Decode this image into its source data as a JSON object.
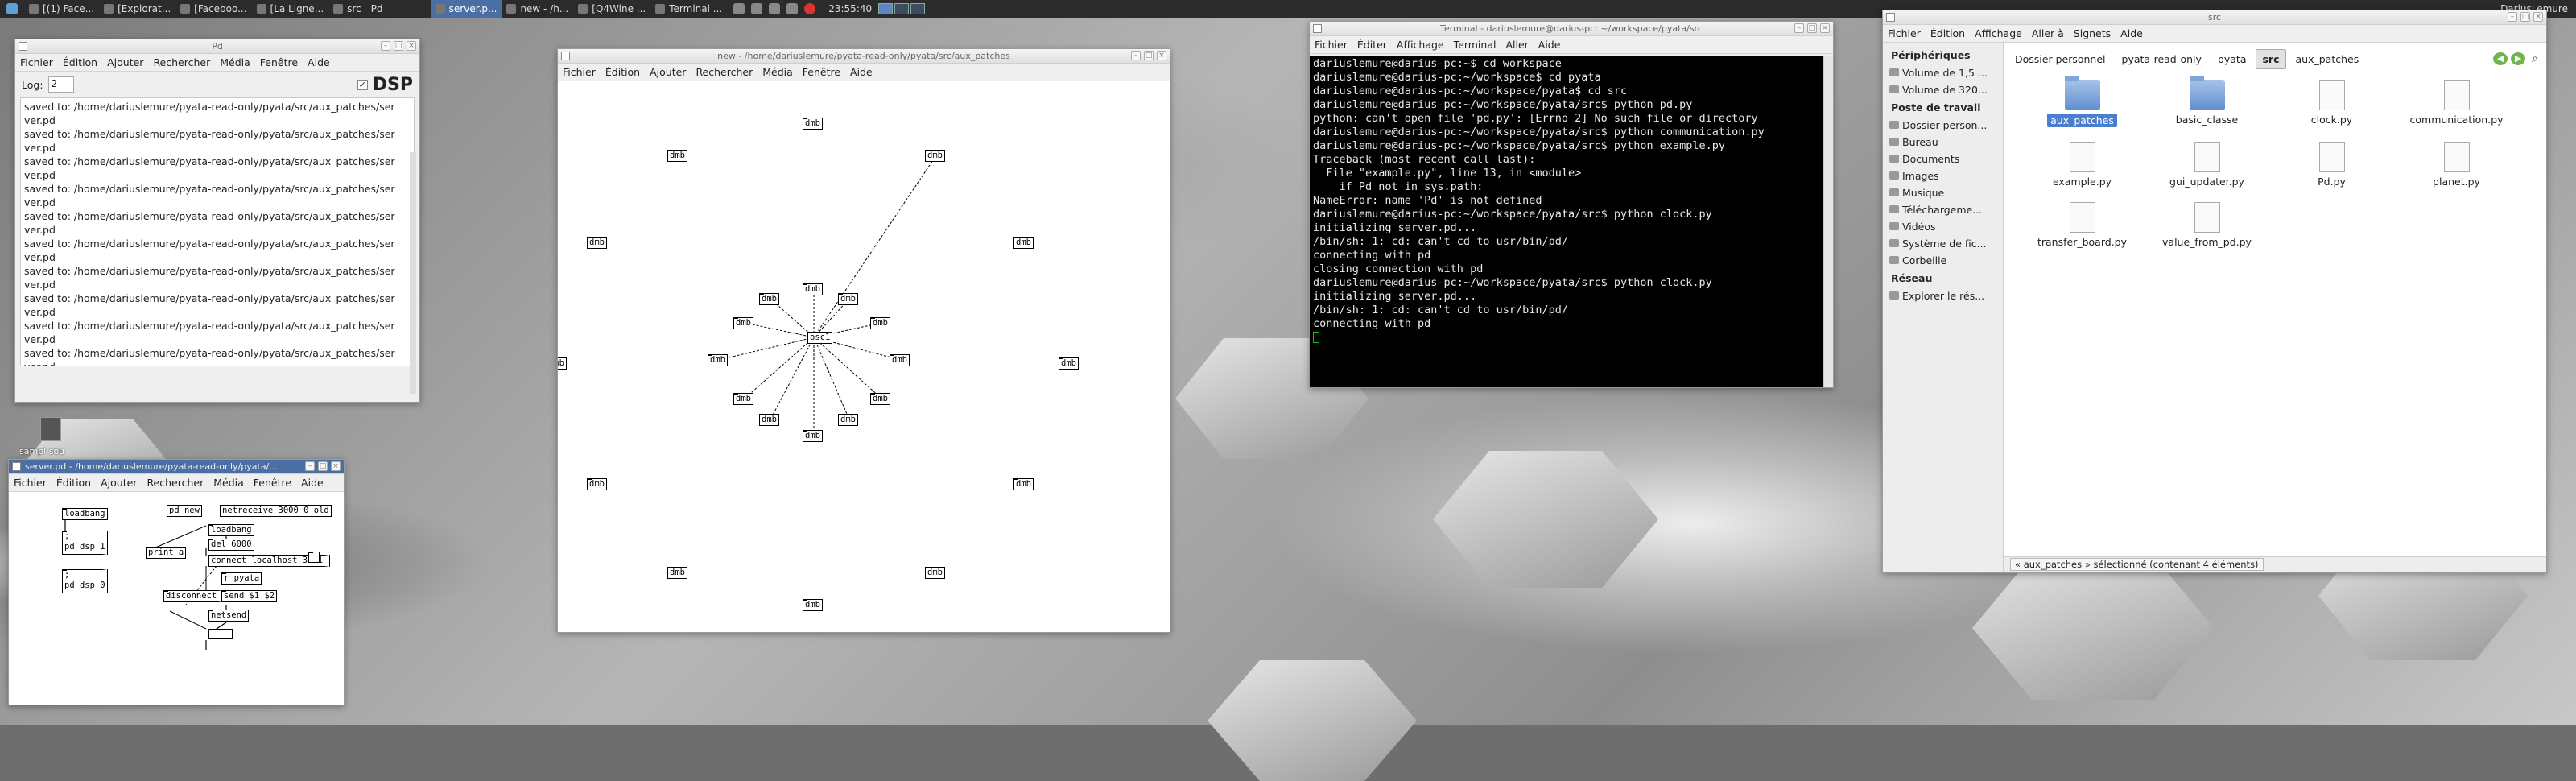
{
  "panel": {
    "tasks": [
      {
        "label": "[(1) Face..."
      },
      {
        "label": "[Explorat..."
      },
      {
        "label": "[Faceboo..."
      },
      {
        "label": "[La Ligne..."
      },
      {
        "label": "src"
      },
      {
        "label": "Pd"
      },
      {
        "label": "server.p..."
      },
      {
        "label": "new - /h..."
      },
      {
        "label": "[Q4Wine ..."
      },
      {
        "label": "Terminal ..."
      }
    ],
    "clock": "23:55:40",
    "user": "DariusLemure"
  },
  "pd_main": {
    "title": "Pd",
    "menu": [
      "Fichier",
      "Édition",
      "Ajouter",
      "Rechercher",
      "Média",
      "Fenêtre",
      "Aide"
    ],
    "log_label": "Log:",
    "log_value": "2",
    "dsp_label": "DSP",
    "dsp_checked": "✓",
    "console": [
      "saved to: /home/dariuslemure/pyata-read-only/pyata/src/aux_patches/ser",
      "ver.pd",
      "saved to: /home/dariuslemure/pyata-read-only/pyata/src/aux_patches/ser",
      "ver.pd",
      "saved to: /home/dariuslemure/pyata-read-only/pyata/src/aux_patches/ser",
      "ver.pd",
      "saved to: /home/dariuslemure/pyata-read-only/pyata/src/aux_patches/ser",
      "ver.pd",
      "saved to: /home/dariuslemure/pyata-read-only/pyata/src/aux_patches/ser",
      "ver.pd",
      "saved to: /home/dariuslemure/pyata-read-only/pyata/src/aux_patches/ser",
      "ver.pd",
      "saved to: /home/dariuslemure/pyata-read-only/pyata/src/aux_patches/ser",
      "ver.pd",
      "saved to: /home/dariuslemure/pyata-read-only/pyata/src/aux_patches/ser",
      "ver.pd",
      "saved to: /home/dariuslemure/pyata-read-only/pyata/src/aux_patches/ser",
      "ver.pd",
      "saved to: /home/dariuslemure/pyata-read-only/pyata/src/aux_patches/ser",
      "ver.pd"
    ]
  },
  "desktop": {
    "sample_label": "sampl sou"
  },
  "server_pd": {
    "title": "server.pd - /home/dariuslemure/pyata-read-only/pyata/...",
    "menu": [
      "Fichier",
      "Édition",
      "Ajouter",
      "Rechercher",
      "Média",
      "Fenêtre",
      "Aide"
    ],
    "objects": {
      "loadbang1": "loadbang",
      "pd_new": "pd new",
      "netreceive": "netreceive 3000 0 old",
      "loadbang2": "loadbang",
      "semi": ";",
      "dsp1": "pd dsp 1",
      "print": "print a",
      "del": "del 6000",
      "connect": "connect localhost 3001",
      "semi2": ";",
      "rpyata": "r pyata",
      "dsp0": "pd dsp 0",
      "disconnect": "disconnect",
      "send": "send $1 $2",
      "netsend": "netsend"
    }
  },
  "new_patch": {
    "title": "new - /home/dariuslemure/pyata-read-only/pyata/src/aux_patches",
    "menu": [
      "Fichier",
      "Édition",
      "Ajouter",
      "Rechercher",
      "Média",
      "Fenêtre",
      "Aide"
    ],
    "center_label": "osc1",
    "node_label": "dmb"
  },
  "terminal": {
    "title": "Terminal - dariuslemure@darius-pc: ~/workspace/pyata/src",
    "menu": [
      "Fichier",
      "Éditer",
      "Affichage",
      "Terminal",
      "Aller",
      "Aide"
    ],
    "lines": [
      "dariuslemure@darius-pc:~$ cd workspace",
      "dariuslemure@darius-pc:~/workspace$ cd pyata",
      "dariuslemure@darius-pc:~/workspace/pyata$ cd src",
      "dariuslemure@darius-pc:~/workspace/pyata/src$ python pd.py",
      "python: can't open file 'pd.py': [Errno 2] No such file or directory",
      "dariuslemure@darius-pc:~/workspace/pyata/src$ python communication.py",
      "dariuslemure@darius-pc:~/workspace/pyata/src$ python example.py",
      "Traceback (most recent call last):",
      "  File \"example.py\", line 13, in <module>",
      "    if Pd not in sys.path:",
      "NameError: name 'Pd' is not defined",
      "dariuslemure@darius-pc:~/workspace/pyata/src$ python clock.py",
      "initializing server.pd...",
      "/bin/sh: 1: cd: can't cd to usr/bin/pd/",
      "connecting with pd",
      "closing connection with pd",
      "dariuslemure@darius-pc:~/workspace/pyata/src$ python clock.py",
      "initializing server.pd...",
      "/bin/sh: 1: cd: can't cd to usr/bin/pd/",
      "connecting with pd"
    ]
  },
  "file_manager": {
    "title": "src",
    "menu": [
      "Fichier",
      "Édition",
      "Affichage",
      "Aller à",
      "Signets",
      "Aide"
    ],
    "breadcrumbs": [
      "Dossier personnel",
      "pyata-read-only",
      "pyata",
      "src",
      "aux_patches"
    ],
    "sidebar": {
      "devices_header": "Périphériques",
      "devices": [
        "Volume de 1,5 ...",
        "Volume de 320..."
      ],
      "workstation_header": "Poste de travail",
      "workstation": [
        "Dossier person...",
        "Bureau",
        "Documents",
        "Images",
        "Musique",
        "Téléchargeme...",
        "Vidéos",
        "Système de fic...",
        "Corbeille"
      ],
      "network_header": "Réseau",
      "network": [
        "Explorer le rés..."
      ]
    },
    "files": [
      {
        "name": "aux_patches",
        "type": "folder"
      },
      {
        "name": "basic_classe",
        "type": "folder"
      },
      {
        "name": "clock.py",
        "type": "file"
      },
      {
        "name": "communication.py",
        "type": "file"
      },
      {
        "name": "example.py",
        "type": "file"
      },
      {
        "name": "gui_updater.py",
        "type": "file"
      },
      {
        "name": "Pd.py",
        "type": "file"
      },
      {
        "name": "planet.py",
        "type": "file"
      },
      {
        "name": "transfer_board.py",
        "type": "file"
      },
      {
        "name": "value_from_pd.py",
        "type": "file"
      }
    ],
    "status": "« aux_patches » sélectionné (contenant 4 éléments)"
  }
}
